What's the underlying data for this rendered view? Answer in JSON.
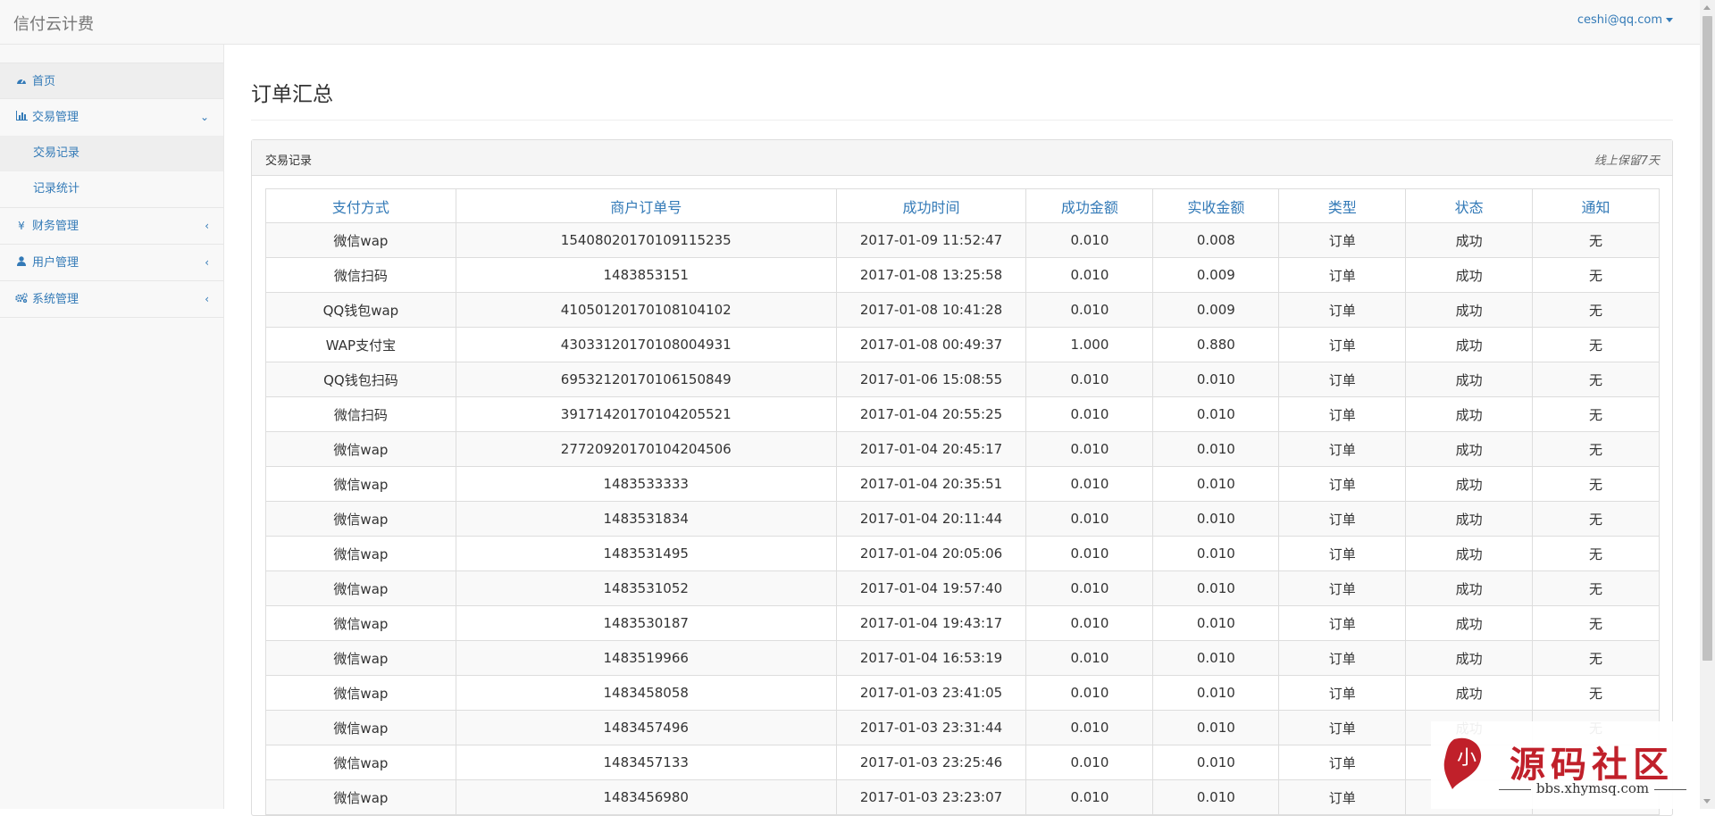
{
  "header": {
    "brand": "信付云计费",
    "user": "ceshi@qq.com"
  },
  "sidebar": {
    "items": [
      {
        "label": "首页",
        "icon": "dashboard-icon"
      },
      {
        "label": "交易管理",
        "icon": "bar-chart-icon",
        "expanded": true,
        "children": [
          {
            "label": "交易记录",
            "active": true
          },
          {
            "label": "记录统计"
          }
        ]
      },
      {
        "label": "财务管理",
        "icon": "yen-icon"
      },
      {
        "label": "用户管理",
        "icon": "user-icon"
      },
      {
        "label": "系统管理",
        "icon": "cogs-icon"
      }
    ]
  },
  "main": {
    "title": "订单汇总",
    "panel_title": "交易记录",
    "panel_note": "线上保留7天",
    "columns": [
      "支付方式",
      "商户订单号",
      "成功时间",
      "成功金额",
      "实收金额",
      "类型",
      "状态",
      "通知"
    ],
    "rows": [
      [
        "微信wap",
        "15408020170109115235",
        "2017-01-09 11:52:47",
        "0.010",
        "0.008",
        "订单",
        "成功",
        "无"
      ],
      [
        "微信扫码",
        "1483853151",
        "2017-01-08 13:25:58",
        "0.010",
        "0.009",
        "订单",
        "成功",
        "无"
      ],
      [
        "QQ钱包wap",
        "41050120170108104102",
        "2017-01-08 10:41:28",
        "0.010",
        "0.009",
        "订单",
        "成功",
        "无"
      ],
      [
        "WAP支付宝",
        "43033120170108004931",
        "2017-01-08 00:49:37",
        "1.000",
        "0.880",
        "订单",
        "成功",
        "无"
      ],
      [
        "QQ钱包扫码",
        "69532120170106150849",
        "2017-01-06 15:08:55",
        "0.010",
        "0.010",
        "订单",
        "成功",
        "无"
      ],
      [
        "微信扫码",
        "39171420170104205521",
        "2017-01-04 20:55:25",
        "0.010",
        "0.010",
        "订单",
        "成功",
        "无"
      ],
      [
        "微信wap",
        "27720920170104204506",
        "2017-01-04 20:45:17",
        "0.010",
        "0.010",
        "订单",
        "成功",
        "无"
      ],
      [
        "微信wap",
        "1483533333",
        "2017-01-04 20:35:51",
        "0.010",
        "0.010",
        "订单",
        "成功",
        "无"
      ],
      [
        "微信wap",
        "1483531834",
        "2017-01-04 20:11:44",
        "0.010",
        "0.010",
        "订单",
        "成功",
        "无"
      ],
      [
        "微信wap",
        "1483531495",
        "2017-01-04 20:05:06",
        "0.010",
        "0.010",
        "订单",
        "成功",
        "无"
      ],
      [
        "微信wap",
        "1483531052",
        "2017-01-04 19:57:40",
        "0.010",
        "0.010",
        "订单",
        "成功",
        "无"
      ],
      [
        "微信wap",
        "1483530187",
        "2017-01-04 19:43:17",
        "0.010",
        "0.010",
        "订单",
        "成功",
        "无"
      ],
      [
        "微信wap",
        "1483519966",
        "2017-01-04 16:53:19",
        "0.010",
        "0.010",
        "订单",
        "成功",
        "无"
      ],
      [
        "微信wap",
        "1483458058",
        "2017-01-03 23:41:05",
        "0.010",
        "0.010",
        "订单",
        "成功",
        "无"
      ],
      [
        "微信wap",
        "1483457496",
        "2017-01-03 23:31:44",
        "0.010",
        "0.010",
        "订单",
        "成功",
        "无"
      ],
      [
        "微信wap",
        "1483457133",
        "2017-01-03 23:25:46",
        "0.010",
        "0.010",
        "订单",
        "",
        ""
      ],
      [
        "微信wap",
        "1483456980",
        "2017-01-03 23:23:07",
        "0.010",
        "0.010",
        "订单",
        "",
        ""
      ]
    ]
  },
  "watermark": {
    "title": "源码社区",
    "url": "bbs.xhymsq.com",
    "logo_char": "小"
  },
  "colors": {
    "accent": "#337ab7",
    "watermark_red": "#c0202a"
  }
}
